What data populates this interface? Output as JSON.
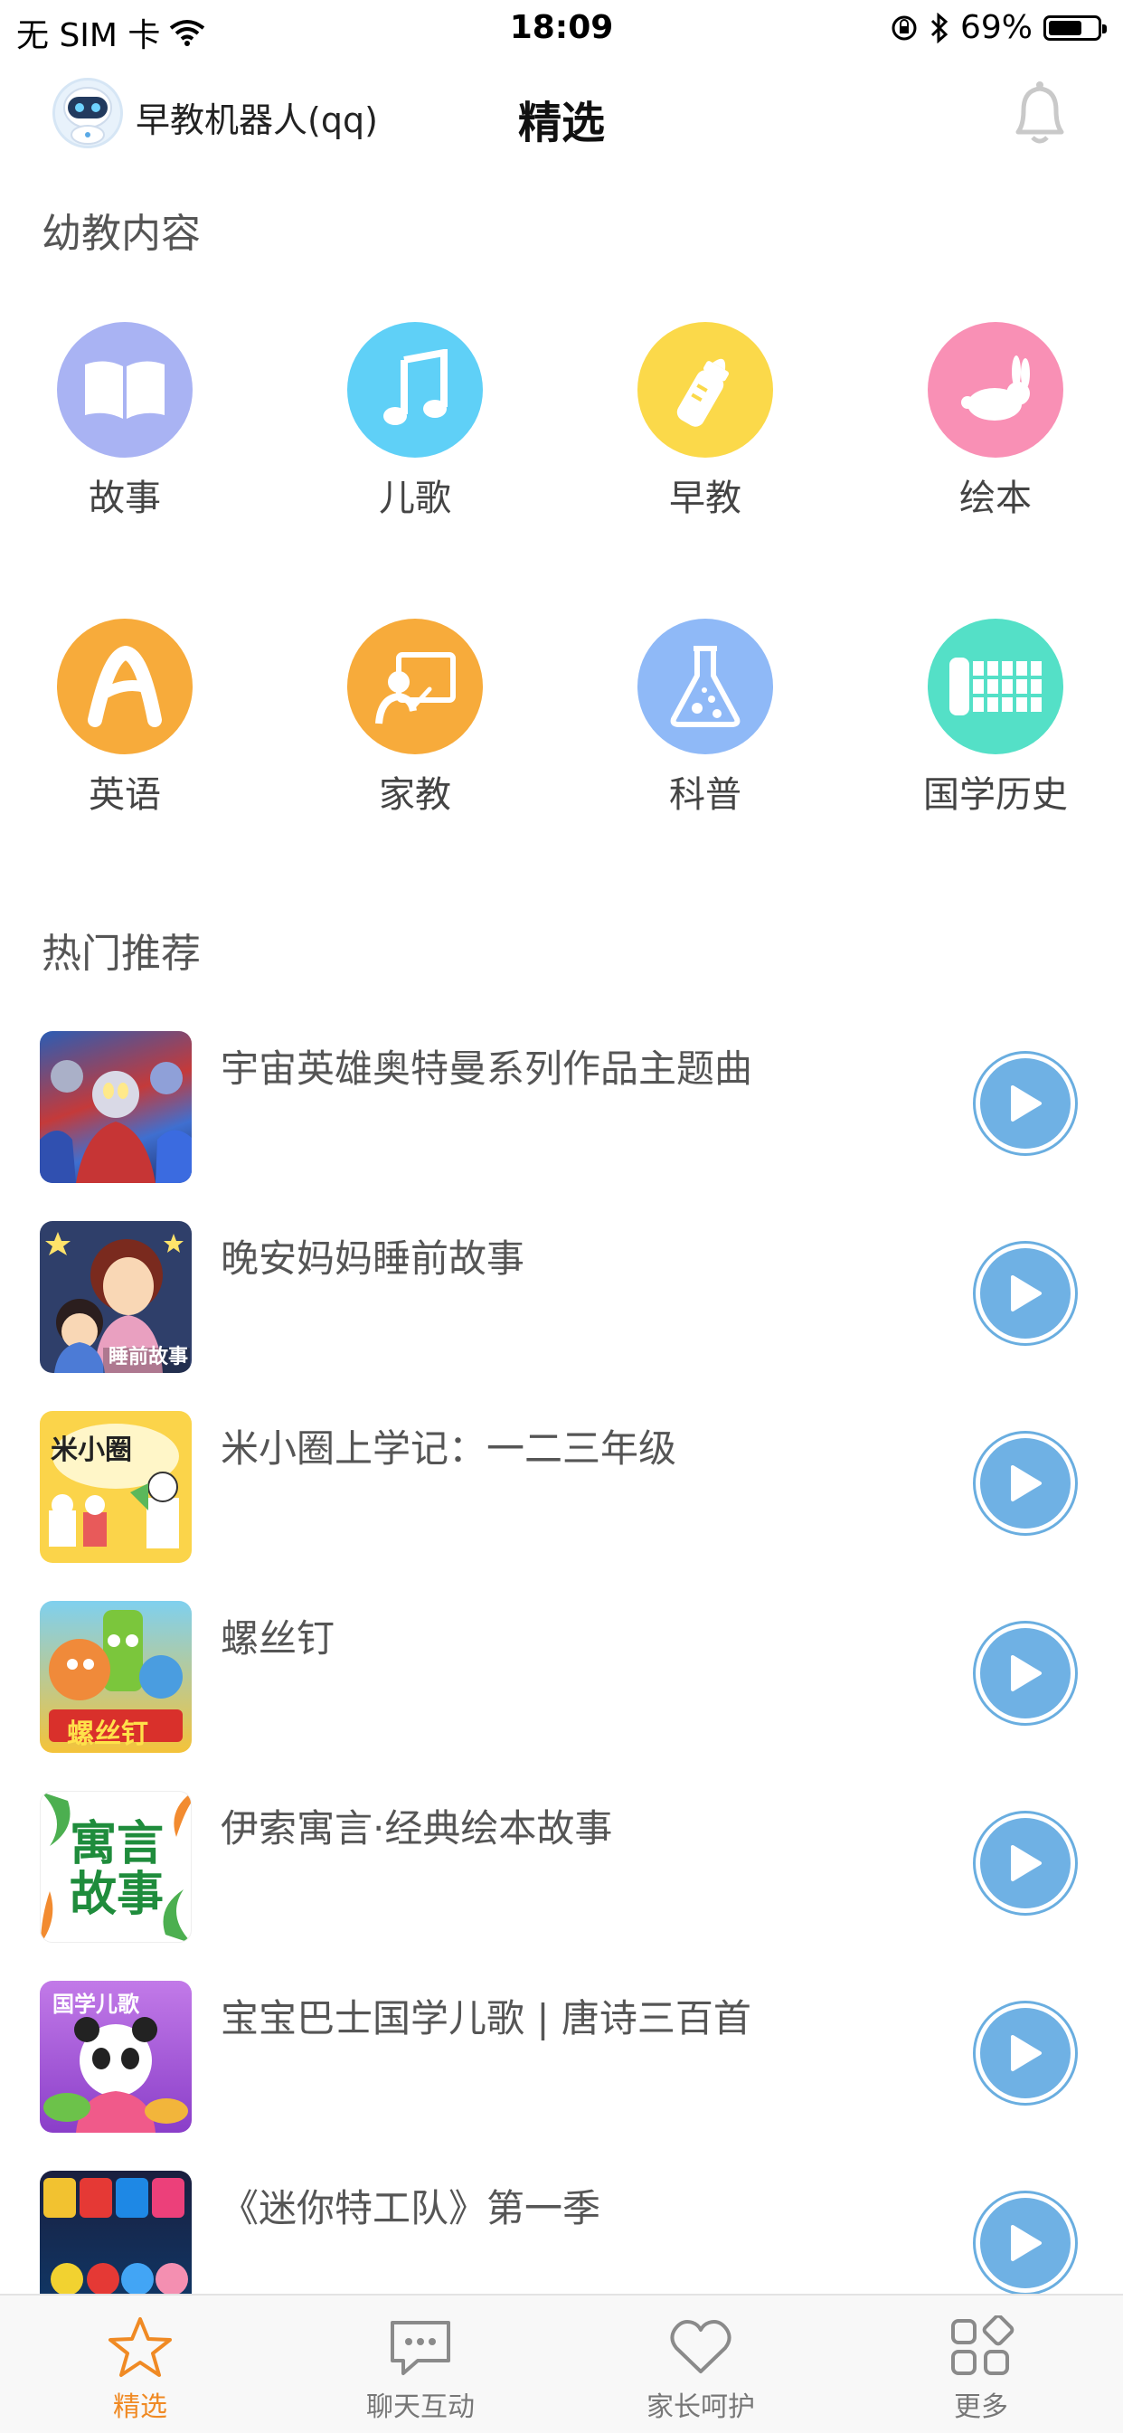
{
  "status_bar": {
    "carrier": "无 SIM 卡",
    "time": "18:09",
    "battery_percent": "69%",
    "battery_level": 0.69
  },
  "header": {
    "device_name": "早教机器人(qq)",
    "title": "精选"
  },
  "sections": {
    "content_title": "幼教内容",
    "hot_title": "热门推荐"
  },
  "categories": [
    {
      "label": "故事",
      "icon": "book-icon",
      "color": "#a9b3f3"
    },
    {
      "label": "儿歌",
      "icon": "music-note-icon",
      "color": "#5fd0f7"
    },
    {
      "label": "早教",
      "icon": "baby-bottle-icon",
      "color": "#fbd94a"
    },
    {
      "label": "绘本",
      "icon": "rabbit-icon",
      "color": "#f990b5"
    },
    {
      "label": "英语",
      "icon": "letter-a-icon",
      "color": "#f7ab3b"
    },
    {
      "label": "家教",
      "icon": "teacher-board-icon",
      "color": "#f7ab3b"
    },
    {
      "label": "科普",
      "icon": "flask-icon",
      "color": "#8fb9f7"
    },
    {
      "label": "国学历史",
      "icon": "bamboo-scroll-icon",
      "color": "#54e0c7"
    }
  ],
  "recommendations": [
    {
      "title": "宇宙英雄奥特曼系列作品主题曲"
    },
    {
      "title": "晚安妈妈睡前故事",
      "thumb_text": "睡前故事"
    },
    {
      "title": "米小圈上学记：一二三年级",
      "thumb_text": "米小圈"
    },
    {
      "title": "螺丝钉",
      "thumb_text": "螺丝钉"
    },
    {
      "title": "伊索寓言·经典绘本故事",
      "thumb_text": "寓言故事"
    },
    {
      "title": "宝宝巴士国学儿歌 | 唐诗三百首",
      "thumb_text": "国学儿歌"
    },
    {
      "title": "《迷你特工队》第一季"
    }
  ],
  "tabs": [
    {
      "label": "精选",
      "icon": "star-icon",
      "active": true
    },
    {
      "label": "聊天互动",
      "icon": "chat-bubble-icon",
      "active": false
    },
    {
      "label": "家长呵护",
      "icon": "heart-icon",
      "active": false
    },
    {
      "label": "更多",
      "icon": "grid-icon",
      "active": false
    }
  ],
  "colors": {
    "accent": "#f08a24",
    "play_button": "#6fb1e4"
  }
}
